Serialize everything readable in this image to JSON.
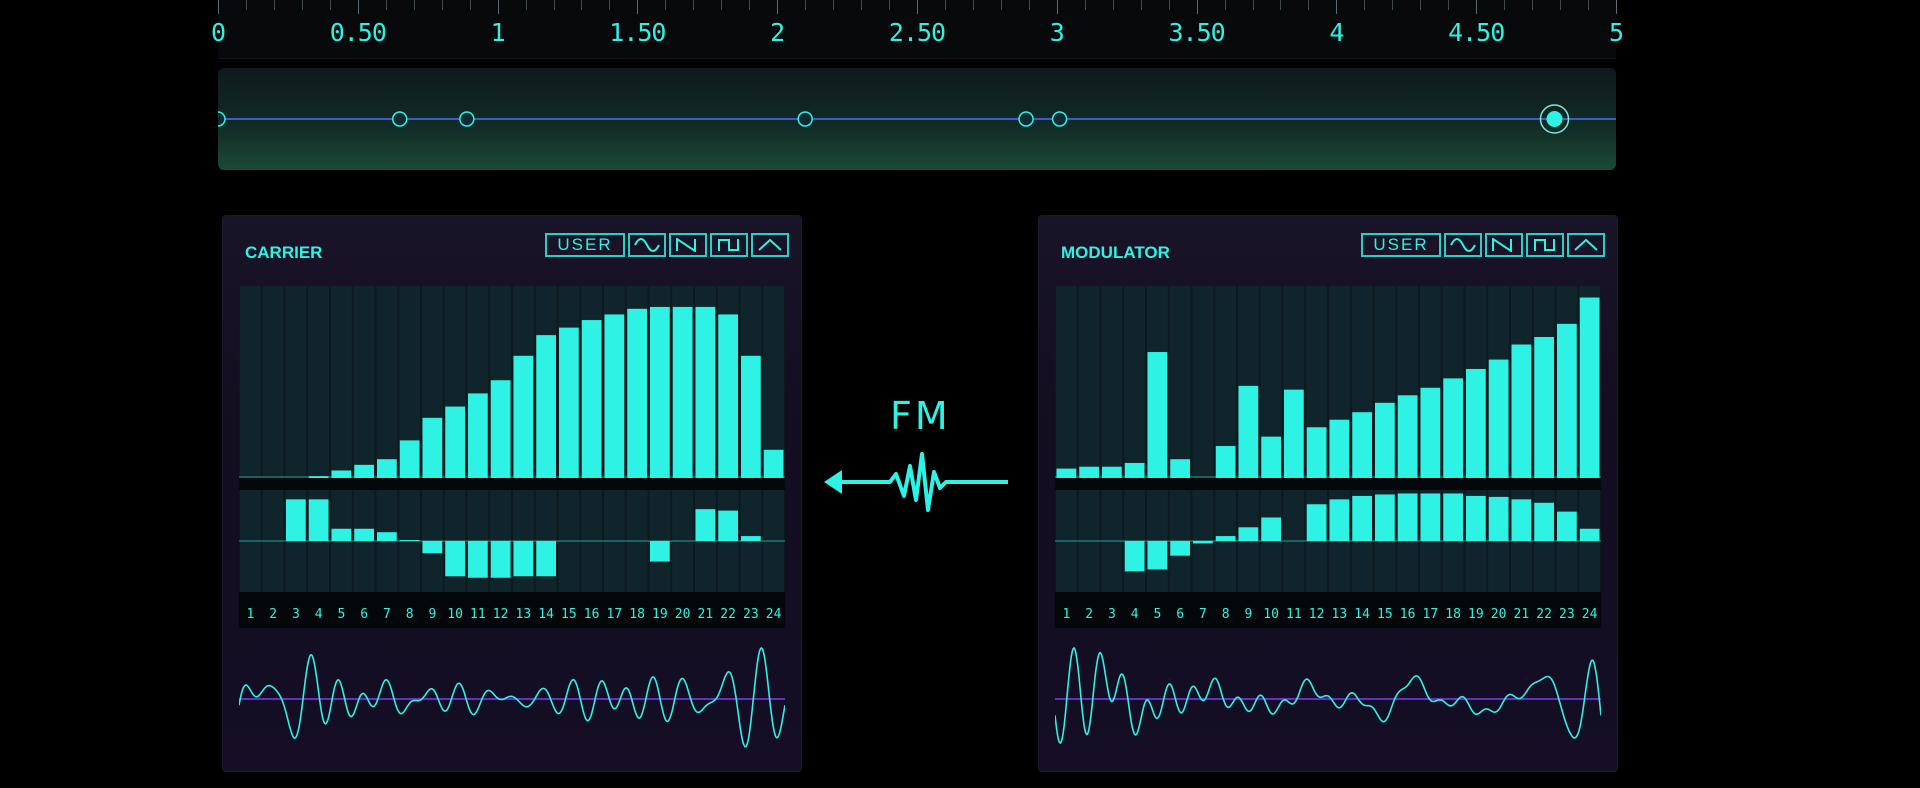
{
  "timeline": {
    "labels": [
      "0",
      "0.50",
      "1",
      "1.50",
      "2",
      "2.50",
      "3",
      "3.50",
      "4",
      "4.50",
      "5"
    ],
    "range": [
      0,
      5
    ],
    "nodes": [
      0,
      0.65,
      0.89,
      2.1,
      2.89,
      3.01,
      4.78
    ],
    "selected_node": 6
  },
  "fm": {
    "label": "FM"
  },
  "carrier": {
    "title": "CARRIER",
    "buttons": {
      "user": "USER",
      "shapes": [
        "sine-icon",
        "saw-icon",
        "square-icon",
        "triangle-icon"
      ]
    },
    "partials": [
      "1",
      "2",
      "3",
      "4",
      "5",
      "6",
      "7",
      "8",
      "9",
      "10",
      "11",
      "12",
      "13",
      "14",
      "15",
      "16",
      "17",
      "18",
      "19",
      "20",
      "21",
      "22",
      "23",
      "24"
    ],
    "amplitudes": [
      0.0,
      0.0,
      0.0,
      0.01,
      0.04,
      0.07,
      0.1,
      0.2,
      0.32,
      0.38,
      0.45,
      0.52,
      0.65,
      0.76,
      0.8,
      0.84,
      0.87,
      0.9,
      0.91,
      0.91,
      0.91,
      0.87,
      0.65,
      0.15
    ],
    "phases": [
      0,
      0,
      0.85,
      0.85,
      0.25,
      0.25,
      0.18,
      0.02,
      -0.25,
      -0.72,
      -0.75,
      -0.75,
      -0.72,
      -0.72,
      0,
      0,
      0,
      0,
      -0.42,
      0,
      0.65,
      0.62,
      0.1,
      0
    ],
    "accent": "#2ef2e3"
  },
  "modulator": {
    "title": "MODULATOR",
    "buttons": {
      "user": "USER",
      "shapes": [
        "sine-icon",
        "saw-icon",
        "square-icon",
        "triangle-icon"
      ]
    },
    "partials": [
      "1",
      "2",
      "3",
      "4",
      "5",
      "6",
      "7",
      "8",
      "9",
      "10",
      "11",
      "12",
      "13",
      "14",
      "15",
      "16",
      "17",
      "18",
      "19",
      "20",
      "21",
      "22",
      "23",
      "24"
    ],
    "amplitudes": [
      0.05,
      0.06,
      0.06,
      0.08,
      0.67,
      0.1,
      0.0,
      0.17,
      0.49,
      0.22,
      0.47,
      0.27,
      0.31,
      0.35,
      0.4,
      0.44,
      0.48,
      0.53,
      0.58,
      0.63,
      0.71,
      0.75,
      0.82,
      0.96
    ],
    "phases": [
      0,
      0,
      0,
      -0.62,
      -0.58,
      -0.3,
      -0.05,
      0.1,
      0.28,
      0.48,
      0,
      0.75,
      0.85,
      0.92,
      0.95,
      0.97,
      0.97,
      0.97,
      0.92,
      0.9,
      0.85,
      0.78,
      0.6,
      0.25
    ],
    "accent": "#2ef2e3"
  }
}
